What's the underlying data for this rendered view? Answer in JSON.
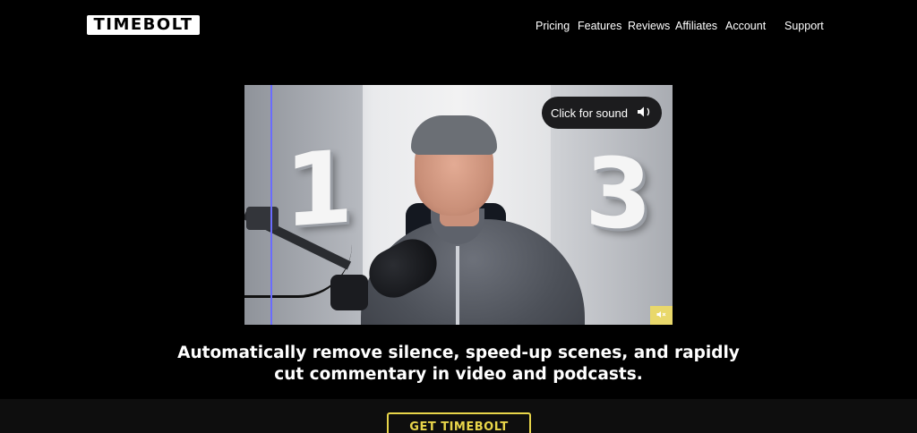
{
  "header": {
    "logo_text": "TIMEBOLT",
    "nav": [
      {
        "label": "Pricing"
      },
      {
        "label": "Features"
      },
      {
        "label": "Reviews"
      },
      {
        "label": "Affiliates"
      },
      {
        "label": "Account"
      },
      {
        "label": "Support"
      }
    ]
  },
  "video": {
    "sound_prompt": "Click for sound",
    "sound_icon": "speaker-icon",
    "mute_icon": "speaker-muted-icon",
    "left_digit": "1",
    "right_digit": "3"
  },
  "hero": {
    "headline_line1": "Automatically remove silence, speed-up scenes, and rapidly",
    "headline_line2": "cut commentary in video and podcasts."
  },
  "cta": {
    "label": "GET TIMEBOLT"
  },
  "colors": {
    "background": "#000000",
    "accent": "#e8d54a",
    "mute_button": "#e9d86b",
    "guide_line": "#6a6cff"
  }
}
